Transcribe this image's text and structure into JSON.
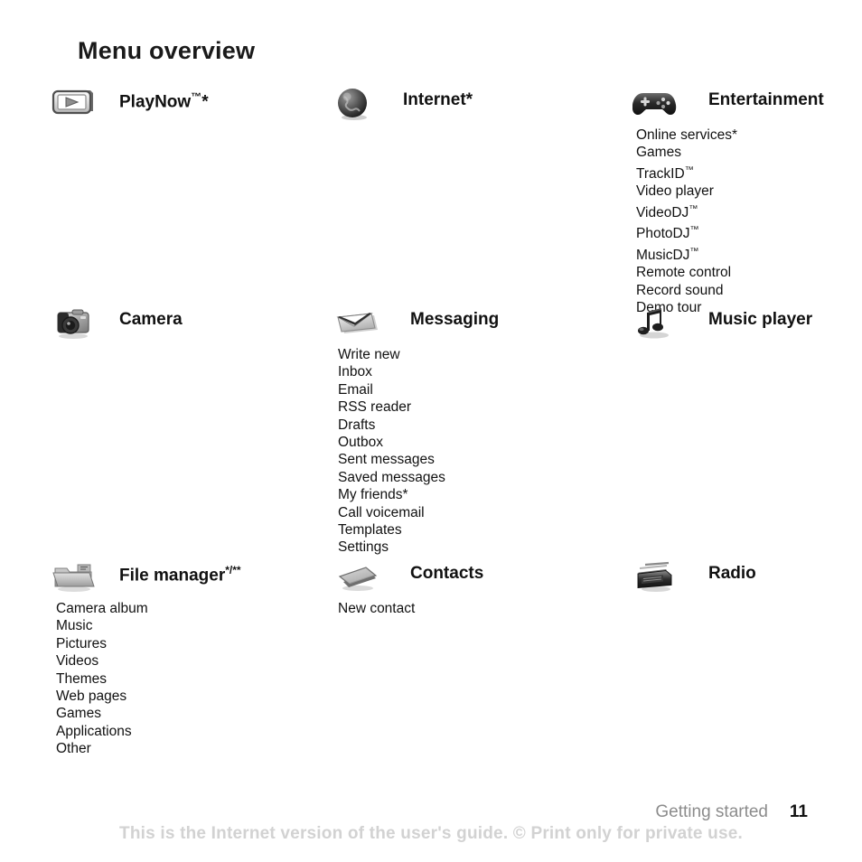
{
  "page": {
    "title": "Menu overview"
  },
  "footer": {
    "section": "Getting started",
    "page_number": "11",
    "notice": "This is the Internet version of the user's guide. © Print only for private use."
  },
  "menu": {
    "entries": [
      {
        "id": "playnow",
        "icon": "playnow-icon",
        "label": "PlayNow™*",
        "items": []
      },
      {
        "id": "internet",
        "icon": "globe-icon",
        "label": "Internet*",
        "items": []
      },
      {
        "id": "entertainment",
        "icon": "gamepad-icon",
        "label": "Entertainment",
        "items": [
          "Online services*",
          "Games",
          "TrackID™",
          "Video player",
          "VideoDJ™",
          "PhotoDJ™",
          "MusicDJ™",
          "Remote control",
          "Record sound",
          "Demo tour"
        ]
      },
      {
        "id": "camera",
        "icon": "camera-icon",
        "label": "Camera",
        "items": []
      },
      {
        "id": "messaging",
        "icon": "envelope-icon",
        "label": "Messaging",
        "items": [
          "Write new",
          "Inbox",
          "Email",
          "RSS reader",
          "Drafts",
          "Outbox",
          "Sent messages",
          "Saved messages",
          "My friends*",
          "Call voicemail",
          "Templates",
          "Settings"
        ]
      },
      {
        "id": "music-player",
        "icon": "music-note-icon",
        "label": "Music player",
        "items": []
      },
      {
        "id": "file-manager",
        "icon": "folder-icon",
        "label": "File manager*/**",
        "items": [
          "Camera album",
          "Music",
          "Pictures",
          "Videos",
          "Themes",
          "Web pages",
          "Games",
          "Applications",
          "Other"
        ]
      },
      {
        "id": "contacts",
        "icon": "contacts-book-icon",
        "label": "Contacts",
        "items": [
          "New contact"
        ]
      },
      {
        "id": "radio",
        "icon": "radio-icon",
        "label": "Radio",
        "items": []
      }
    ]
  }
}
